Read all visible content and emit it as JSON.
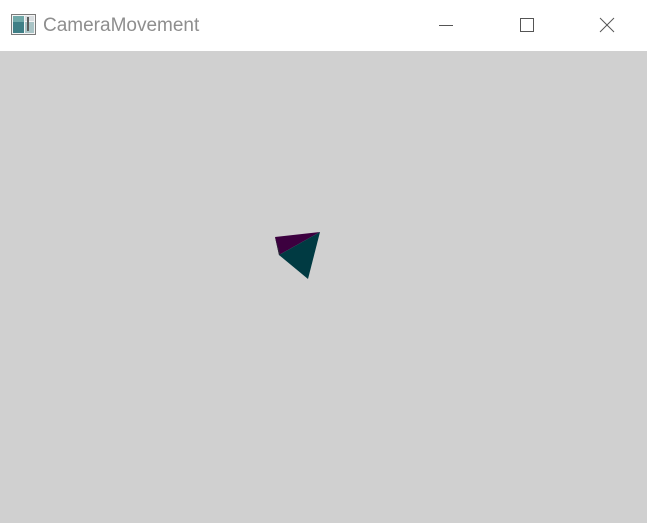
{
  "window": {
    "title": "CameraMovement",
    "icon": "opengl-app-icon",
    "controls": {
      "minimize": "minimize-icon",
      "maximize": "maximize-icon",
      "close": "close-icon"
    }
  },
  "viewport": {
    "background_color": "#d0d0d0",
    "object": {
      "shape": "tetrahedron",
      "face_colors": [
        "#3c003f",
        "#003a42",
        "#2b2638"
      ]
    }
  }
}
